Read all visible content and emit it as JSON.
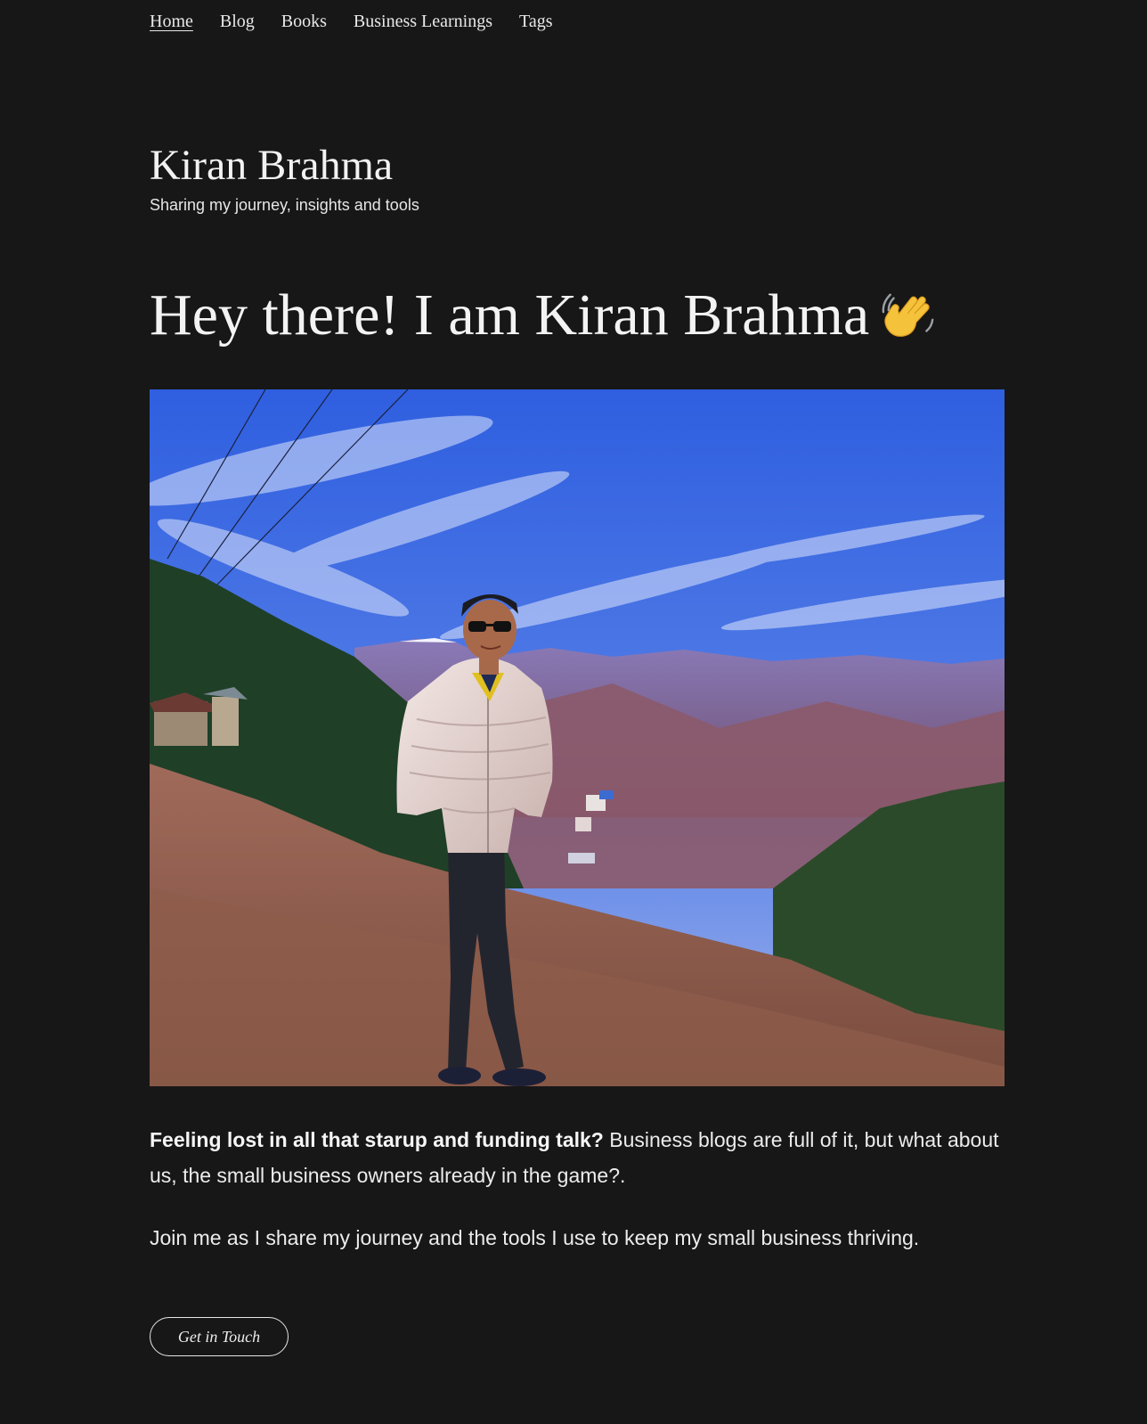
{
  "nav": {
    "items": [
      {
        "label": "Home",
        "active": true
      },
      {
        "label": "Blog",
        "active": false
      },
      {
        "label": "Books",
        "active": false
      },
      {
        "label": "Business Learnings",
        "active": false
      },
      {
        "label": "Tags",
        "active": false
      }
    ]
  },
  "site": {
    "title": "Kiran Brahma",
    "tagline": "Sharing my journey, insights and tools"
  },
  "hero": {
    "heading": "Hey there! I am Kiran Brahma",
    "emoji_icon": "waving-hand-icon"
  },
  "intro": {
    "bold_lead": "Feeling lost in all that starup and funding talk?",
    "rest": " Business blogs are full of it, but what about us, the small business owners already in the game?.",
    "second_paragraph": "Join me as I share my journey and the tools I use to keep my small business thriving."
  },
  "cta": {
    "label": "Get in Touch"
  },
  "colors": {
    "background": "#171717",
    "text": "#f2f2f2",
    "sky": "#3f6fe6"
  }
}
